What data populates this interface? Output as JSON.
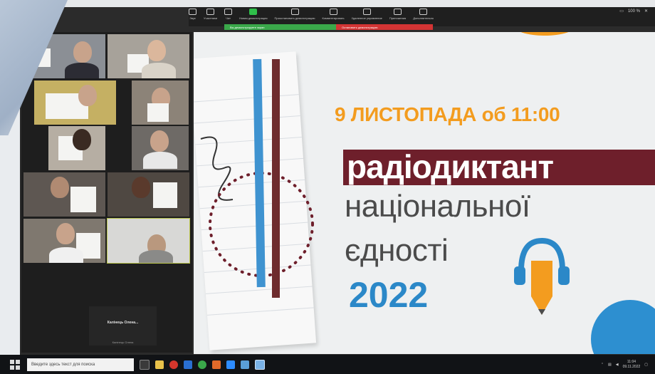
{
  "toolbar": {
    "items": [
      {
        "label": "Звук",
        "icon": "audio-icon",
        "green": false
      },
      {
        "label": "Участники",
        "icon": "participants-icon",
        "green": false
      },
      {
        "label": "Чат",
        "icon": "chat-icon",
        "green": false
      },
      {
        "label": "Новая демонстрация",
        "icon": "share-icon",
        "green": true
      },
      {
        "label": "Приостановить демонстрацию",
        "icon": "pause-icon",
        "green": false
      },
      {
        "label": "Комментировать",
        "icon": "annotate-icon",
        "green": false
      },
      {
        "label": "Удаленное управление",
        "icon": "remote-control-icon",
        "green": false
      },
      {
        "label": "Приложения",
        "icon": "apps-icon",
        "green": false
      },
      {
        "label": "Дополнительно",
        "icon": "more-icon",
        "green": false
      }
    ],
    "zoom_level": "100 %"
  },
  "notifications": {
    "green": "Вы демонстрируете экран",
    "red": "Остановить демонстрацию"
  },
  "gallery": {
    "name_card_big": "Калінець Олена...",
    "name_card_small": "Калінець Олена"
  },
  "slide": {
    "date": "9 ЛИСТОПАДА об 11:00",
    "title": "радіодиктант",
    "line2": "національної",
    "line3": "єдності",
    "year": "2022",
    "colors": {
      "orange": "#f39c1f",
      "maroon": "#6e1f2b",
      "blue": "#2b88c8",
      "gray": "#4b4b4b"
    }
  },
  "taskbar": {
    "search_placeholder": "Введите здесь текст для поиска",
    "clock_time": "11:04",
    "clock_date": "09.11.2022"
  }
}
